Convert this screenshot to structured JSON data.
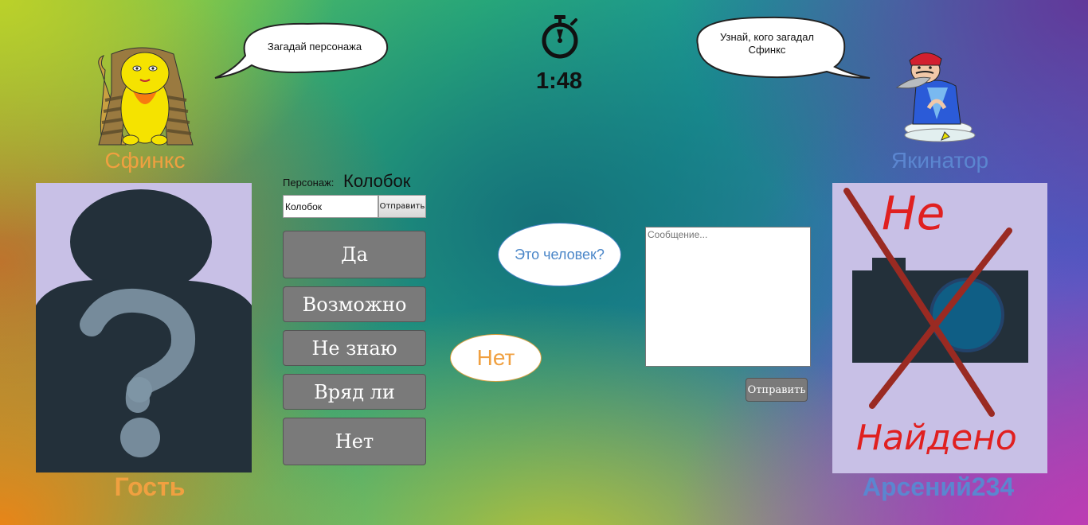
{
  "bubbles": {
    "left": "Загадай персонажа",
    "right": "Узнай, кого загадал Сфинкс"
  },
  "timer": {
    "value": "1:48",
    "icon": "stopwatch-icon"
  },
  "players": {
    "left_role": "Сфинкс",
    "right_role": "Якинатор",
    "left_user": "Гость",
    "right_user": "Арсений234"
  },
  "character": {
    "label": "Персонаж:",
    "value": "Колобок",
    "input_value": "Колобок",
    "submit_label": "Отправить"
  },
  "answers": [
    "Да",
    "Возможно",
    "Не знаю",
    "Вряд ли",
    "Нет"
  ],
  "chat": {
    "question": "Это человек?",
    "answer": "Нет",
    "message_placeholder": "Сообщение...",
    "send_label": "Отправить"
  },
  "right_avatar": {
    "text_top": "Не",
    "text_bottom": "Найдено"
  },
  "colors": {
    "orange": "#f0a040",
    "blue": "#5b86d0",
    "avatar_bg": "#c8c0e6",
    "silhouette": "#23303a"
  }
}
